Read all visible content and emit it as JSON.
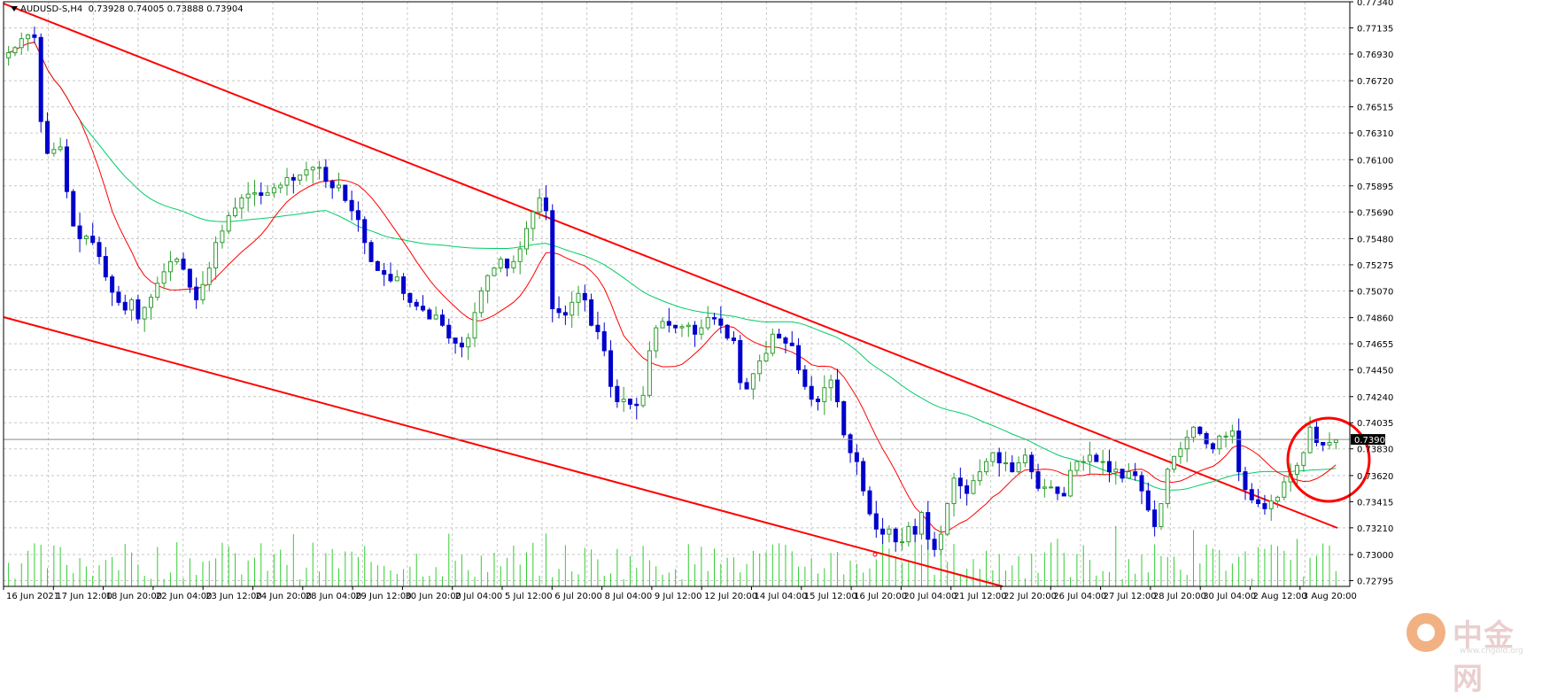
{
  "header": {
    "symbol": "AUDUSD-S,H4",
    "ohlc": "0.73928 0.74005 0.73888 0.73904"
  },
  "current_price_label": "0.73904",
  "watermark": {
    "name": "中金网",
    "url": "www.cngold.org"
  },
  "colors": {
    "bull_candle": "#2d9e2d",
    "bear_candle": "#0000cc",
    "ma_fast": "#ff0000",
    "ma_slow": "#00cc66",
    "trendline": "#ff0000",
    "grid": "#c8c8c8",
    "volume": "#32cd32",
    "highlight_circle": "#ff0000"
  },
  "chart_data": {
    "type": "candlestick",
    "timeframe": "H4",
    "ylim": [
      0.7275,
      0.7734
    ],
    "grid": true,
    "y_ticks": [
      "0.77340",
      "0.77135",
      "0.76930",
      "0.76720",
      "0.76515",
      "0.76310",
      "0.76100",
      "0.75895",
      "0.75690",
      "0.75480",
      "0.75275",
      "0.75070",
      "0.74860",
      "0.74655",
      "0.74450",
      "0.74240",
      "0.74035",
      "0.73830",
      "0.73620",
      "0.73415",
      "0.73210",
      "0.73000",
      "0.72795"
    ],
    "x_ticks": [
      "16 Jun 2021",
      "17 Jun 12:00",
      "18 Jun 20:00",
      "22 Jun 04:00",
      "23 Jun 12:00",
      "24 Jun 20:00",
      "28 Jun 04:00",
      "29 Jun 12:00",
      "30 Jun 20:00",
      "2 Jul 04:00",
      "5 Jul 12:00",
      "6 Jul 20:00",
      "8 Jul 04:00",
      "9 Jul 12:00",
      "12 Jul 20:00",
      "14 Jul 04:00",
      "15 Jul 12:00",
      "16 Jul 20:00",
      "20 Jul 04:00",
      "21 Jul 12:00",
      "22 Jul 20:00",
      "26 Jul 04:00",
      "27 Jul 12:00",
      "28 Jul 20:00",
      "30 Jul 04:00",
      "2 Aug 12:00",
      "3 Aug 20:00"
    ],
    "closes": [
      0.7694,
      0.7698,
      0.7705,
      0.7708,
      0.7706,
      0.764,
      0.7615,
      0.7618,
      0.762,
      0.7585,
      0.7558,
      0.7548,
      0.755,
      0.7545,
      0.7534,
      0.7518,
      0.7506,
      0.7498,
      0.7492,
      0.75,
      0.7485,
      0.7494,
      0.7502,
      0.7513,
      0.7522,
      0.753,
      0.7532,
      0.7524,
      0.751,
      0.75,
      0.7512,
      0.7525,
      0.7545,
      0.7554,
      0.7566,
      0.7572,
      0.758,
      0.7583,
      0.7584,
      0.7582,
      0.7584,
      0.7588,
      0.759,
      0.7596,
      0.7594,
      0.7598,
      0.7602,
      0.7604,
      0.7604,
      0.7593,
      0.7588,
      0.759,
      0.7578,
      0.757,
      0.7563,
      0.7545,
      0.753,
      0.7523,
      0.752,
      0.7515,
      0.7518,
      0.7505,
      0.7498,
      0.7495,
      0.7492,
      0.7485,
      0.7488,
      0.748,
      0.747,
      0.7466,
      0.7463,
      0.747,
      0.749,
      0.7507,
      0.7519,
      0.7525,
      0.7532,
      0.7525,
      0.753,
      0.754,
      0.7556,
      0.7569,
      0.758,
      0.757,
      0.7493,
      0.749,
      0.7488,
      0.7498,
      0.7505,
      0.75,
      0.748,
      0.7475,
      0.746,
      0.7432,
      0.742,
      0.7422,
      0.7418,
      0.7417,
      0.7425,
      0.746,
      0.7478,
      0.7483,
      0.748,
      0.7478,
      0.7479,
      0.748,
      0.7473,
      0.7478,
      0.7486,
      0.7485,
      0.748,
      0.747,
      0.7468,
      0.7435,
      0.743,
      0.7442,
      0.7452,
      0.7458,
      0.7473,
      0.747,
      0.7466,
      0.7464,
      0.7445,
      0.7432,
      0.7422,
      0.742,
      0.7431,
      0.7437,
      0.742,
      0.7394,
      0.738,
      0.7373,
      0.735,
      0.7332,
      0.732,
      0.7316,
      0.732,
      0.731,
      0.731,
      0.7322,
      0.7316,
      0.7333,
      0.7312,
      0.7304,
      0.7316,
      0.734,
      0.736,
      0.7354,
      0.7348,
      0.7358,
      0.7365,
      0.7373,
      0.738,
      0.7372,
      0.7372,
      0.7365,
      0.7372,
      0.7378,
      0.7365,
      0.7352,
      0.7353,
      0.7353,
      0.7348,
      0.7346,
      0.7366,
      0.7373,
      0.7373,
      0.7378,
      0.7373,
      0.7373,
      0.7365,
      0.7367,
      0.736,
      0.7365,
      0.7362,
      0.735,
      0.7335,
      0.7322,
      0.734,
      0.7367,
      0.7377,
      0.7383,
      0.7392,
      0.74,
      0.7395,
      0.7387,
      0.7383,
      0.7393,
      0.7393,
      0.7397,
      0.7365,
      0.7351,
      0.7343,
      0.734,
      0.7336,
      0.7342,
      0.7345,
      0.7357,
      0.7363,
      0.737,
      0.738,
      0.74,
      0.7388,
      0.7386,
      0.7388,
      0.739
    ]
  }
}
